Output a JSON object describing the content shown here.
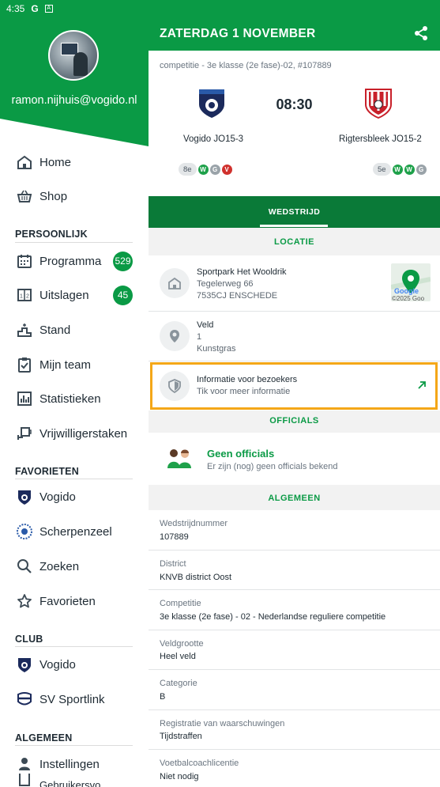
{
  "status_bar": {
    "time": "4:35",
    "icons": [
      "google-g-icon",
      "notification-box-icon"
    ]
  },
  "drawer": {
    "email": "ramon.nijhuis@vogido.nl",
    "top_items": [
      {
        "label": "Home",
        "icon": "home-icon"
      },
      {
        "label": "Shop",
        "icon": "basket-icon"
      }
    ],
    "sections": [
      {
        "title": "PERSOONLIJK",
        "items": [
          {
            "label": "Programma",
            "icon": "calendar-icon",
            "badge": "529"
          },
          {
            "label": "Uitslagen",
            "icon": "scoreboard-icon",
            "badge": "45"
          },
          {
            "label": "Stand",
            "icon": "podium-icon"
          },
          {
            "label": "Mijn team",
            "icon": "clipboard-check-icon"
          },
          {
            "label": "Statistieken",
            "icon": "bar-chart-icon"
          },
          {
            "label": "Vrijwilligerstaken",
            "icon": "cup-hand-icon"
          }
        ]
      },
      {
        "title": "FAVORIETEN",
        "items": [
          {
            "label": "Vogido",
            "icon": "club-crest-icon"
          },
          {
            "label": "Scherpenzeel",
            "icon": "club-crest-icon"
          },
          {
            "label": "Zoeken",
            "icon": "search-icon"
          },
          {
            "label": "Favorieten",
            "icon": "star-icon"
          }
        ]
      },
      {
        "title": "CLUB",
        "items": [
          {
            "label": "Vogido",
            "icon": "club-crest-icon"
          },
          {
            "label": "SV Sportlink",
            "icon": "sportlink-icon"
          }
        ]
      },
      {
        "title": "ALGEMEEN",
        "items": [
          {
            "label": "Instellingen",
            "icon": "person-settings-icon"
          },
          {
            "label": "Gebruikersvo...",
            "icon": "document-icon"
          }
        ]
      }
    ]
  },
  "header": {
    "title": "ZATERDAG 1 NOVEMBER",
    "share_icon": "share-icon"
  },
  "match": {
    "competition": "competitie - 3e klasse (2e fase)-02, #107889",
    "time": "08:30",
    "home": {
      "name": "Vogido JO15-3",
      "rank": "8e",
      "form": [
        "W",
        "G",
        "V"
      ]
    },
    "away": {
      "name": "Rigtersbleek JO15-2",
      "rank": "5e",
      "form": [
        "W",
        "W",
        "G"
      ]
    }
  },
  "tabs": [
    {
      "label": "WEDSTRIJD",
      "active": true
    }
  ],
  "locatie": {
    "heading": "LOCATIE",
    "address": {
      "name": "Sportpark Het Wooldrik",
      "street": "Tegelerweg 66",
      "city": "7535CJ ENSCHEDE",
      "map_credit": "Google",
      "map_year": "©2025 Goo"
    },
    "veld": {
      "label": "Veld",
      "number": "1",
      "surface": "Kunstgras"
    },
    "visitors": {
      "title": "Informatie voor bezoekers",
      "subtitle": "Tik voor meer informatie"
    }
  },
  "officials": {
    "heading": "OFFICIALS",
    "title": "Geen officials",
    "subtitle": "Er zijn (nog) geen officials bekend"
  },
  "algemeen": {
    "heading": "ALGEMEEN",
    "rows": [
      {
        "label": "Wedstrijdnummer",
        "value": "107889"
      },
      {
        "label": "District",
        "value": "KNVB district Oost"
      },
      {
        "label": "Competitie",
        "value": "3e klasse (2e fase) - 02 - Nederlandse reguliere competitie"
      },
      {
        "label": "Veldgrootte",
        "value": "Heel veld"
      },
      {
        "label": "Categorie",
        "value": "B"
      },
      {
        "label": "Registratie van waarschuwingen",
        "value": "Tijdstraffen"
      },
      {
        "label": "Voetbalcoachlicentie",
        "value": "Niet nodig"
      }
    ]
  },
  "colors": {
    "brand_green": "#0a9a45",
    "dark_green": "#0a7a38",
    "highlight": "#f4a718",
    "loss_red": "#d0312d"
  }
}
